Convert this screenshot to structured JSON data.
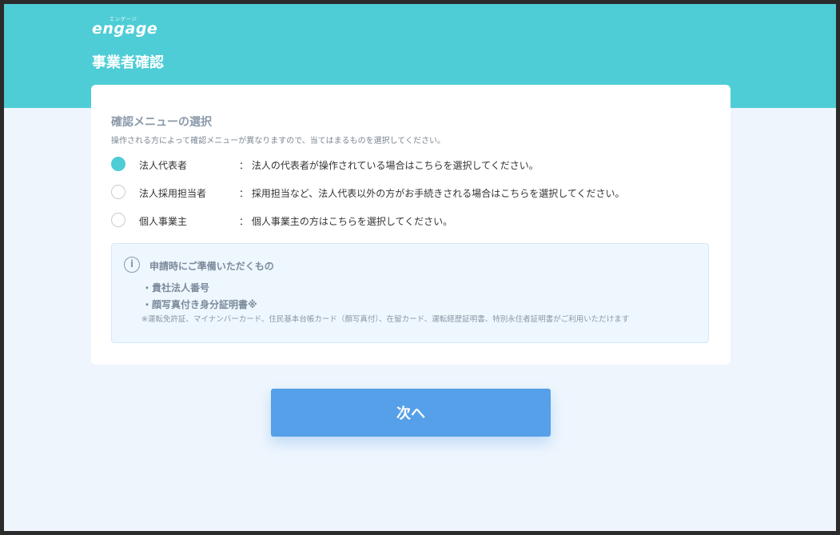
{
  "header": {
    "logo_kana": "エンゲージ",
    "logo_text": "engage",
    "title": "事業者確認",
    "band_color": "#4ecdd6"
  },
  "menu": {
    "title": "確認メニューの選択",
    "description": "操作される方によって確認メニューが異なりますので、当てはまるものを選択してください。",
    "selected_index": 0,
    "options": [
      {
        "label": "法人代表者",
        "desc": "： 法人の代表者が操作されている場合はこちらを選択してください。"
      },
      {
        "label": "法人採用担当者",
        "desc": "： 採用担当など、法人代表以外の方がお手続きされる場合はこちらを選択してください。"
      },
      {
        "label": "個人事業主",
        "desc": "： 個人事業主の方はこちらを選択してください。"
      }
    ]
  },
  "info": {
    "icon": "info-icon",
    "icon_glyph": "i",
    "title": "申請時にご準備いただくもの",
    "items": [
      "・貴社法人番号",
      "・顔写真付き身分証明書※"
    ],
    "note": "※運転免許証、マイナンバーカード、住民基本台帳カード（顔写真付）、在留カード、運転経歴証明書、特別永住者証明書がご利用いただけます"
  },
  "next_button": {
    "label": "次へ",
    "color": "#55a0e8"
  }
}
